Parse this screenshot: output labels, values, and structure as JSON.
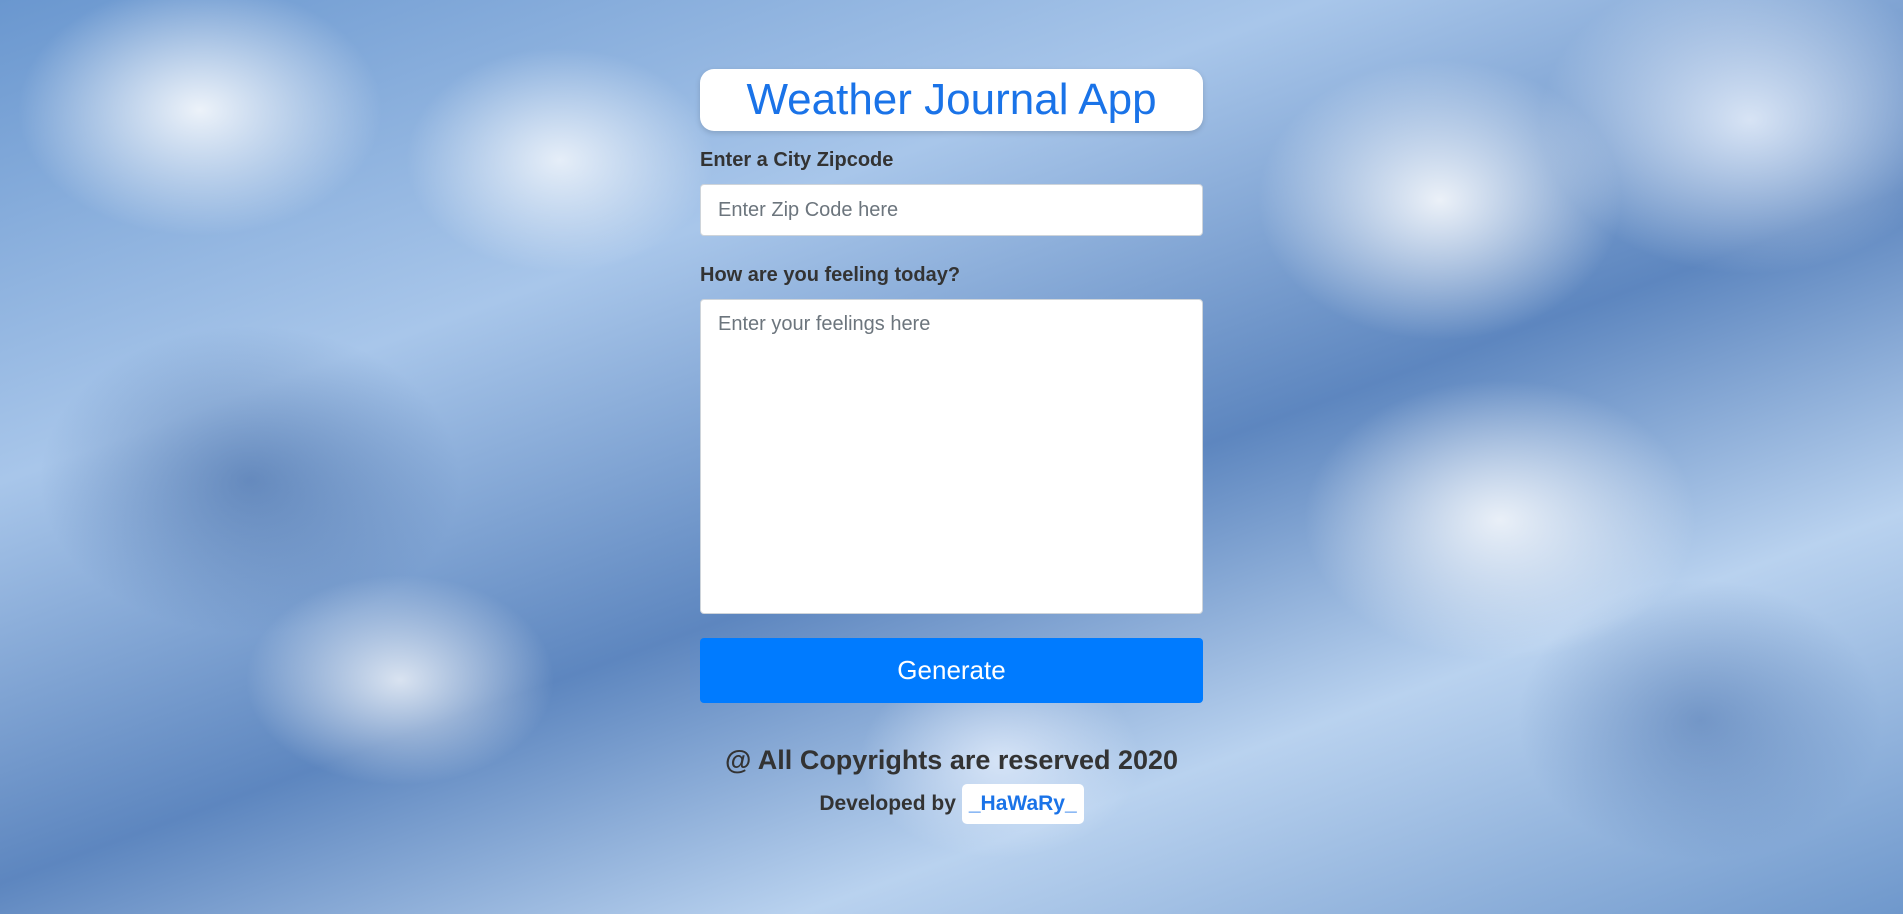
{
  "header": {
    "title": "Weather Journal App"
  },
  "form": {
    "zip_label": "Enter a City Zipcode",
    "zip_placeholder": "Enter Zip Code here",
    "feelings_label": "How are you feeling today?",
    "feelings_placeholder": "Enter your feelings here",
    "generate_label": "Generate"
  },
  "footer": {
    "copyright": "@ All Copyrights are reserved 2020",
    "developed_by": "Developed by",
    "developer_name": "_HaWaRy_"
  },
  "colors": {
    "accent": "#1a73e8",
    "button": "#007bff"
  },
  "background": "clouds-sky-image"
}
